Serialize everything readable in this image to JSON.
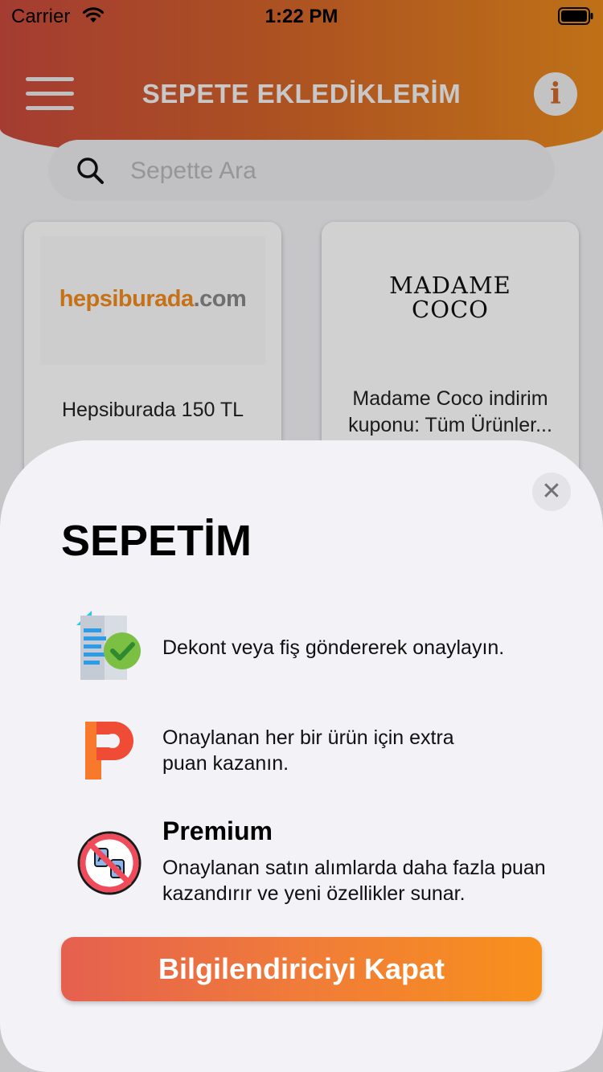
{
  "status": {
    "carrier": "Carrier",
    "time": "1:22 PM"
  },
  "nav": {
    "title": "SEPETE EKLEDİKLERİM",
    "info_glyph": "i"
  },
  "search": {
    "placeholder": "Sepette Ara"
  },
  "cards": [
    {
      "logo_orange": "hepsiburada",
      "logo_grey": ".com",
      "title": "Hepsiburada 150 TL"
    },
    {
      "logo_line1": "MADAME",
      "logo_line2": "COCO",
      "title_line1": "Madame Coco indirim",
      "title_line2": "kuponu: Tüm Ürünler..."
    }
  ],
  "sheet": {
    "close_glyph": "✕",
    "title": "SEPETİM",
    "features": [
      {
        "icon": "receipt-check-icon",
        "text": "Dekont veya fiş göndererek onaylayın."
      },
      {
        "icon": "points-p-icon",
        "line1": "Onaylanan her bir ürün için extra",
        "line2": "puan kazanın."
      },
      {
        "icon": "no-ads-icon",
        "heading": "Premium",
        "line1": "Onaylanan satın alımlarda daha fazla puan",
        "line2": "kazandırır ve yeni özellikler sunar."
      }
    ],
    "button_label": "Bilgilendiriciyi Kapat"
  },
  "colors": {
    "header_start": "#c94a3d",
    "header_end": "#e98a1d",
    "button_start": "#e5604f",
    "button_end": "#f8901b"
  }
}
